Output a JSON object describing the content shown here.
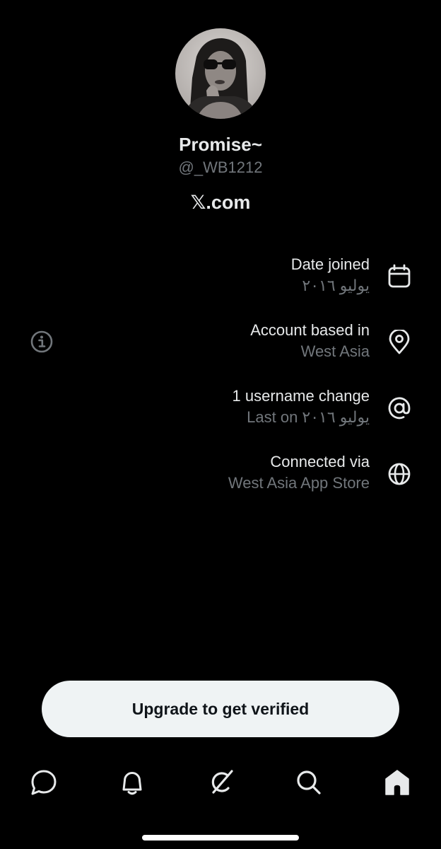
{
  "profile": {
    "display_name": "Promise~",
    "handle": "@_WB1212",
    "site": "𝕏.com",
    "avatar_icon": "profile-photo"
  },
  "info_rows": [
    {
      "label": "Date joined",
      "value": "يوليو ٢٠١٦",
      "icon": "calendar-icon"
    },
    {
      "label": "Account based in",
      "value": "West Asia",
      "icon": "location-pin-icon"
    },
    {
      "label": "1 username change",
      "value": "Last on يوليو ٢٠١٦",
      "icon": "at-sign-icon"
    },
    {
      "label": "Connected via",
      "value": "West Asia App Store",
      "icon": "globe-icon"
    }
  ],
  "upgrade_button": {
    "label": "Upgrade to get verified"
  },
  "tab_bar": {
    "items": [
      {
        "name": "messages",
        "icon": "chat-bubble-icon"
      },
      {
        "name": "notifications",
        "icon": "bell-icon"
      },
      {
        "name": "grok",
        "icon": "grok-icon"
      },
      {
        "name": "search",
        "icon": "search-icon"
      },
      {
        "name": "home",
        "icon": "home-icon",
        "active": true
      }
    ]
  },
  "colors": {
    "background": "#000000",
    "primary_text": "#e7e9ea",
    "secondary_text": "#71767b",
    "button_bg": "#eff3f4",
    "button_text": "#0f1419"
  }
}
